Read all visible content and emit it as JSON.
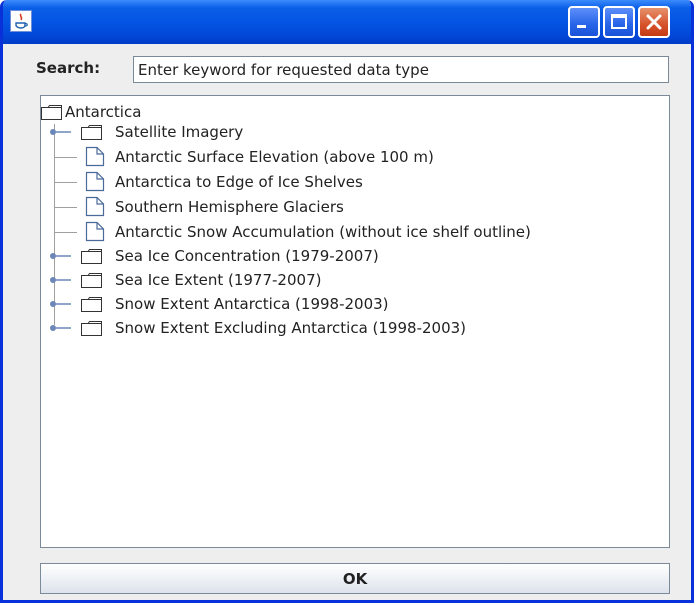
{
  "window": {
    "title": "",
    "controls": [
      "minimize-icon",
      "maximize-icon",
      "close-icon"
    ]
  },
  "search": {
    "label": "Search:",
    "value": "Enter keyword for requested data type"
  },
  "tree": {
    "root": "Antarctica",
    "items": [
      {
        "label": "Satellite Imagery",
        "type": "folder"
      },
      {
        "label": "Antarctic Surface Elevation (above 100 m)",
        "type": "leaf"
      },
      {
        "label": "Antarctica to  Edge of Ice Shelves",
        "type": "leaf"
      },
      {
        "label": "Southern Hemisphere Glaciers",
        "type": "leaf"
      },
      {
        "label": "Antarctic Snow Accumulation (without ice shelf outline)",
        "type": "leaf"
      },
      {
        "label": "Sea Ice Concentration (1979-2007)",
        "type": "folder"
      },
      {
        "label": "Sea Ice Extent (1977-2007)",
        "type": "folder"
      },
      {
        "label": "Snow Extent Antarctica (1998-2003)",
        "type": "folder"
      },
      {
        "label": "Snow Extent Excluding Antarctica (1998-2003)",
        "type": "folder"
      }
    ]
  },
  "buttons": {
    "ok": "OK"
  },
  "colors": {
    "titlebar": "#0554e3",
    "close_button": "#d6522a",
    "panel": "#eeeeee"
  }
}
